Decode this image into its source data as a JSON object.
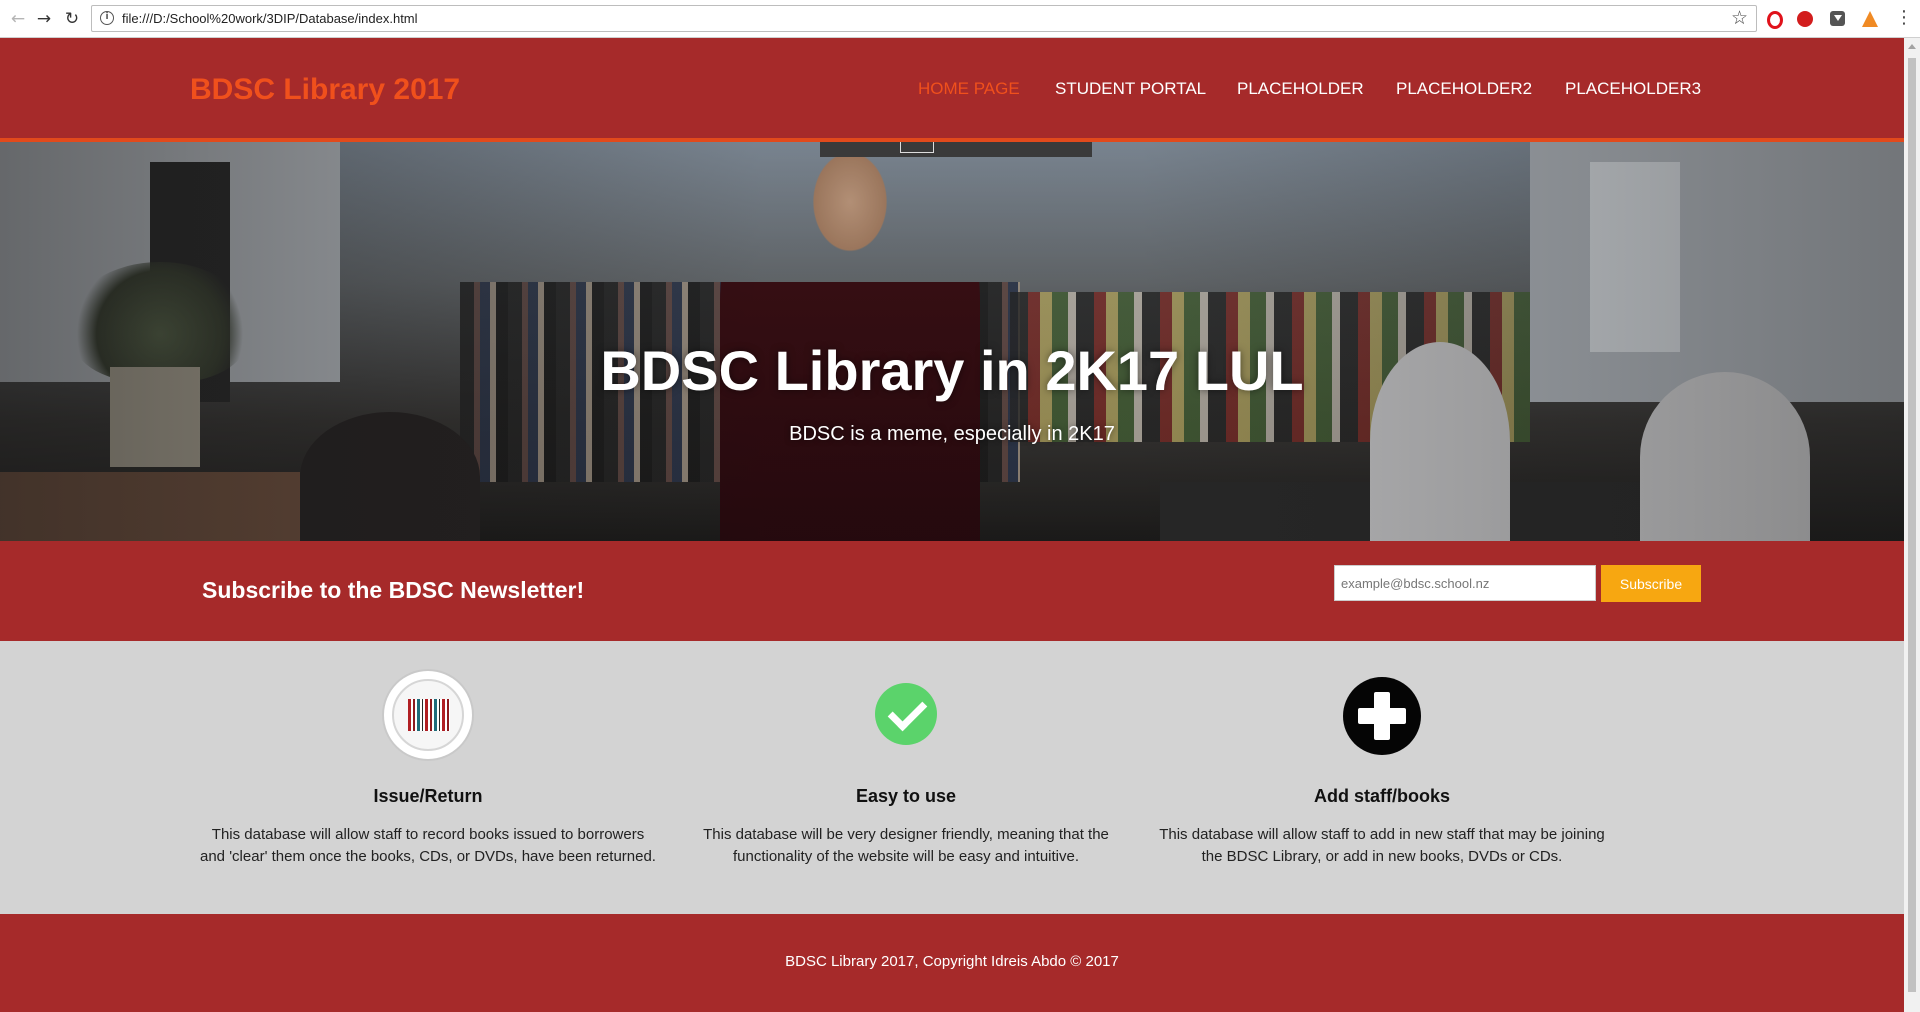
{
  "browser": {
    "url": "file:///D:/School%20work/3DIP/Database/index.html",
    "back_icon": "arrow-left-icon",
    "forward_icon": "arrow-right-icon",
    "reload_icon": "reload-icon",
    "bookmark_icon": "star-icon"
  },
  "header": {
    "brand": "BDSC Library 2017",
    "nav": [
      {
        "label": "HOME PAGE",
        "active": true
      },
      {
        "label": "STUDENT PORTAL",
        "active": false
      },
      {
        "label": "PLACEHOLDER",
        "active": false
      },
      {
        "label": "PLACEHOLDER2",
        "active": false
      },
      {
        "label": "PLACEHOLDER3",
        "active": false
      }
    ]
  },
  "hero": {
    "title": "BDSC Library in 2K17 LUL",
    "subtitle": "BDSC is a meme, especially in 2K17"
  },
  "newsletter": {
    "heading": "Subscribe to the BDSC Newsletter!",
    "email_placeholder": "example@bdsc.school.nz",
    "email_value": "",
    "button": "Subscribe"
  },
  "features": [
    {
      "icon": "barcode-icon",
      "title": "Issue/Return",
      "text": "This database will allow staff to record books issued to borrowers and 'clear' them once the books, CDs, or DVDs, have been returned."
    },
    {
      "icon": "check-icon",
      "title": "Easy to use",
      "text": "This database will be very designer friendly, meaning that the functionality of the website will be easy and intuitive."
    },
    {
      "icon": "plus-icon",
      "title": "Add staff/books",
      "text": "This database will allow staff to add in new staff that may be joining the BDSC Library, or add in new books, DVDs or CDs."
    }
  ],
  "footer": {
    "copyright": "BDSC Library 2017, Copyright Idreis Abdo © 2017"
  },
  "colors": {
    "header_bg": "#a62a2a",
    "accent": "#f0501c",
    "subscribe_button": "#f7a711",
    "features_bg": "#d3d3d3"
  }
}
